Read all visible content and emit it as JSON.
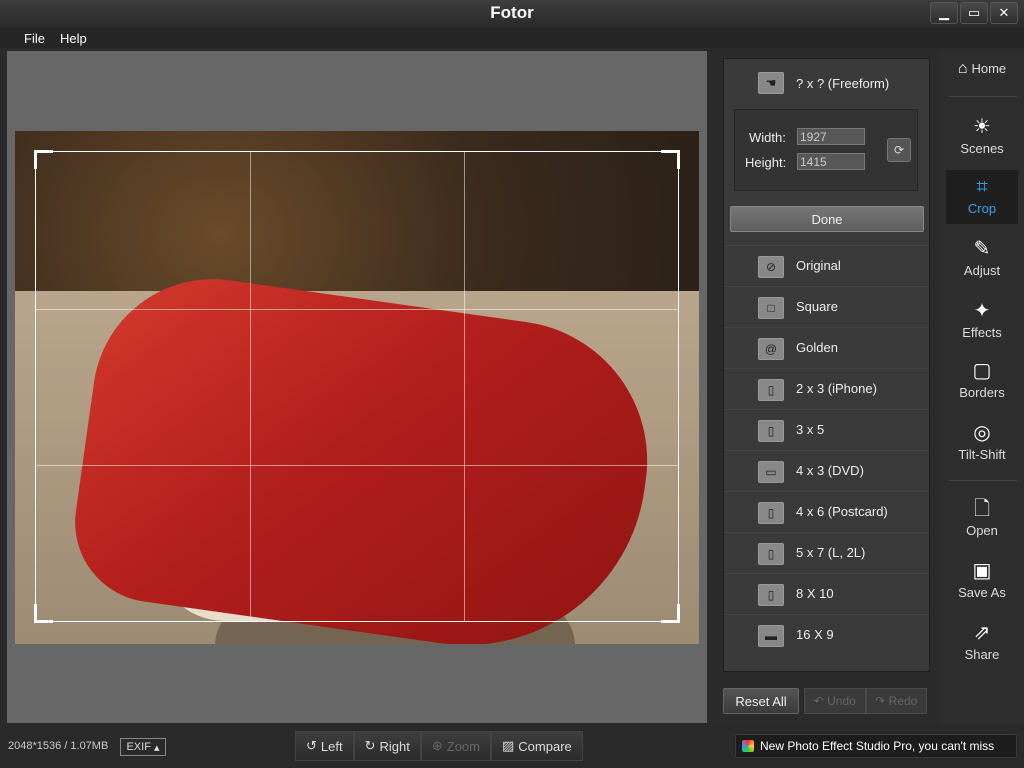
{
  "window": {
    "title": "Fotor",
    "minimize": "▁",
    "maximize": "▭",
    "close": "✕"
  },
  "menu": {
    "file": "File",
    "help": "Help"
  },
  "crop_panel": {
    "freeform_label": "? x ?  (Freeform)",
    "width_label": "Width:",
    "height_label": "Height:",
    "width_value": "1927",
    "height_value": "1415",
    "done_label": "Done",
    "presets": [
      {
        "label": "Original",
        "icon": "no-symbol-icon"
      },
      {
        "label": "Square",
        "icon": "square-icon"
      },
      {
        "label": "Golden",
        "icon": "spiral-icon"
      },
      {
        "label": "2 x 3   (iPhone)",
        "icon": "portrait-rect-icon"
      },
      {
        "label": "3 x 5",
        "icon": "portrait-rect-icon"
      },
      {
        "label": "4 x 3   (DVD)",
        "icon": "landscape-rect-icon"
      },
      {
        "label": "4 x 6   (Postcard)",
        "icon": "portrait-rect-icon"
      },
      {
        "label": "5 x 7   (L, 2L)",
        "icon": "portrait-rect-icon"
      },
      {
        "label": "8 X 10",
        "icon": "portrait-rect-icon"
      },
      {
        "label": "16 X 9",
        "icon": "wide-rect-icon"
      }
    ],
    "reset_label": "Reset All",
    "undo_label": "Undo",
    "redo_label": "Redo"
  },
  "sidebar": {
    "items": [
      {
        "label": "Home",
        "icon": "home-icon"
      },
      {
        "label": "Scenes",
        "icon": "sun-icon"
      },
      {
        "label": "Crop",
        "icon": "crop-icon",
        "active": true
      },
      {
        "label": "Adjust",
        "icon": "pencil-icon"
      },
      {
        "label": "Effects",
        "icon": "sparkle-icon"
      },
      {
        "label": "Borders",
        "icon": "rounded-rect-icon"
      },
      {
        "label": "Tilt-Shift",
        "icon": "target-icon"
      },
      {
        "label": "Open",
        "icon": "document-icon"
      },
      {
        "label": "Save As",
        "icon": "save-icon"
      },
      {
        "label": "Share",
        "icon": "share-icon"
      }
    ]
  },
  "status": {
    "image_info": "2048*1536 / 1.07MB",
    "exif_label": "EXIF",
    "tools": {
      "left": "Left",
      "right": "Right",
      "zoom": "Zoom",
      "compare": "Compare"
    },
    "promo_text": "New Photo Effect Studio Pro, you can't miss"
  },
  "colors": {
    "accent": "#3aa0f0",
    "panel_bg": "#3a3a3a",
    "canvas_bg": "#676767"
  }
}
